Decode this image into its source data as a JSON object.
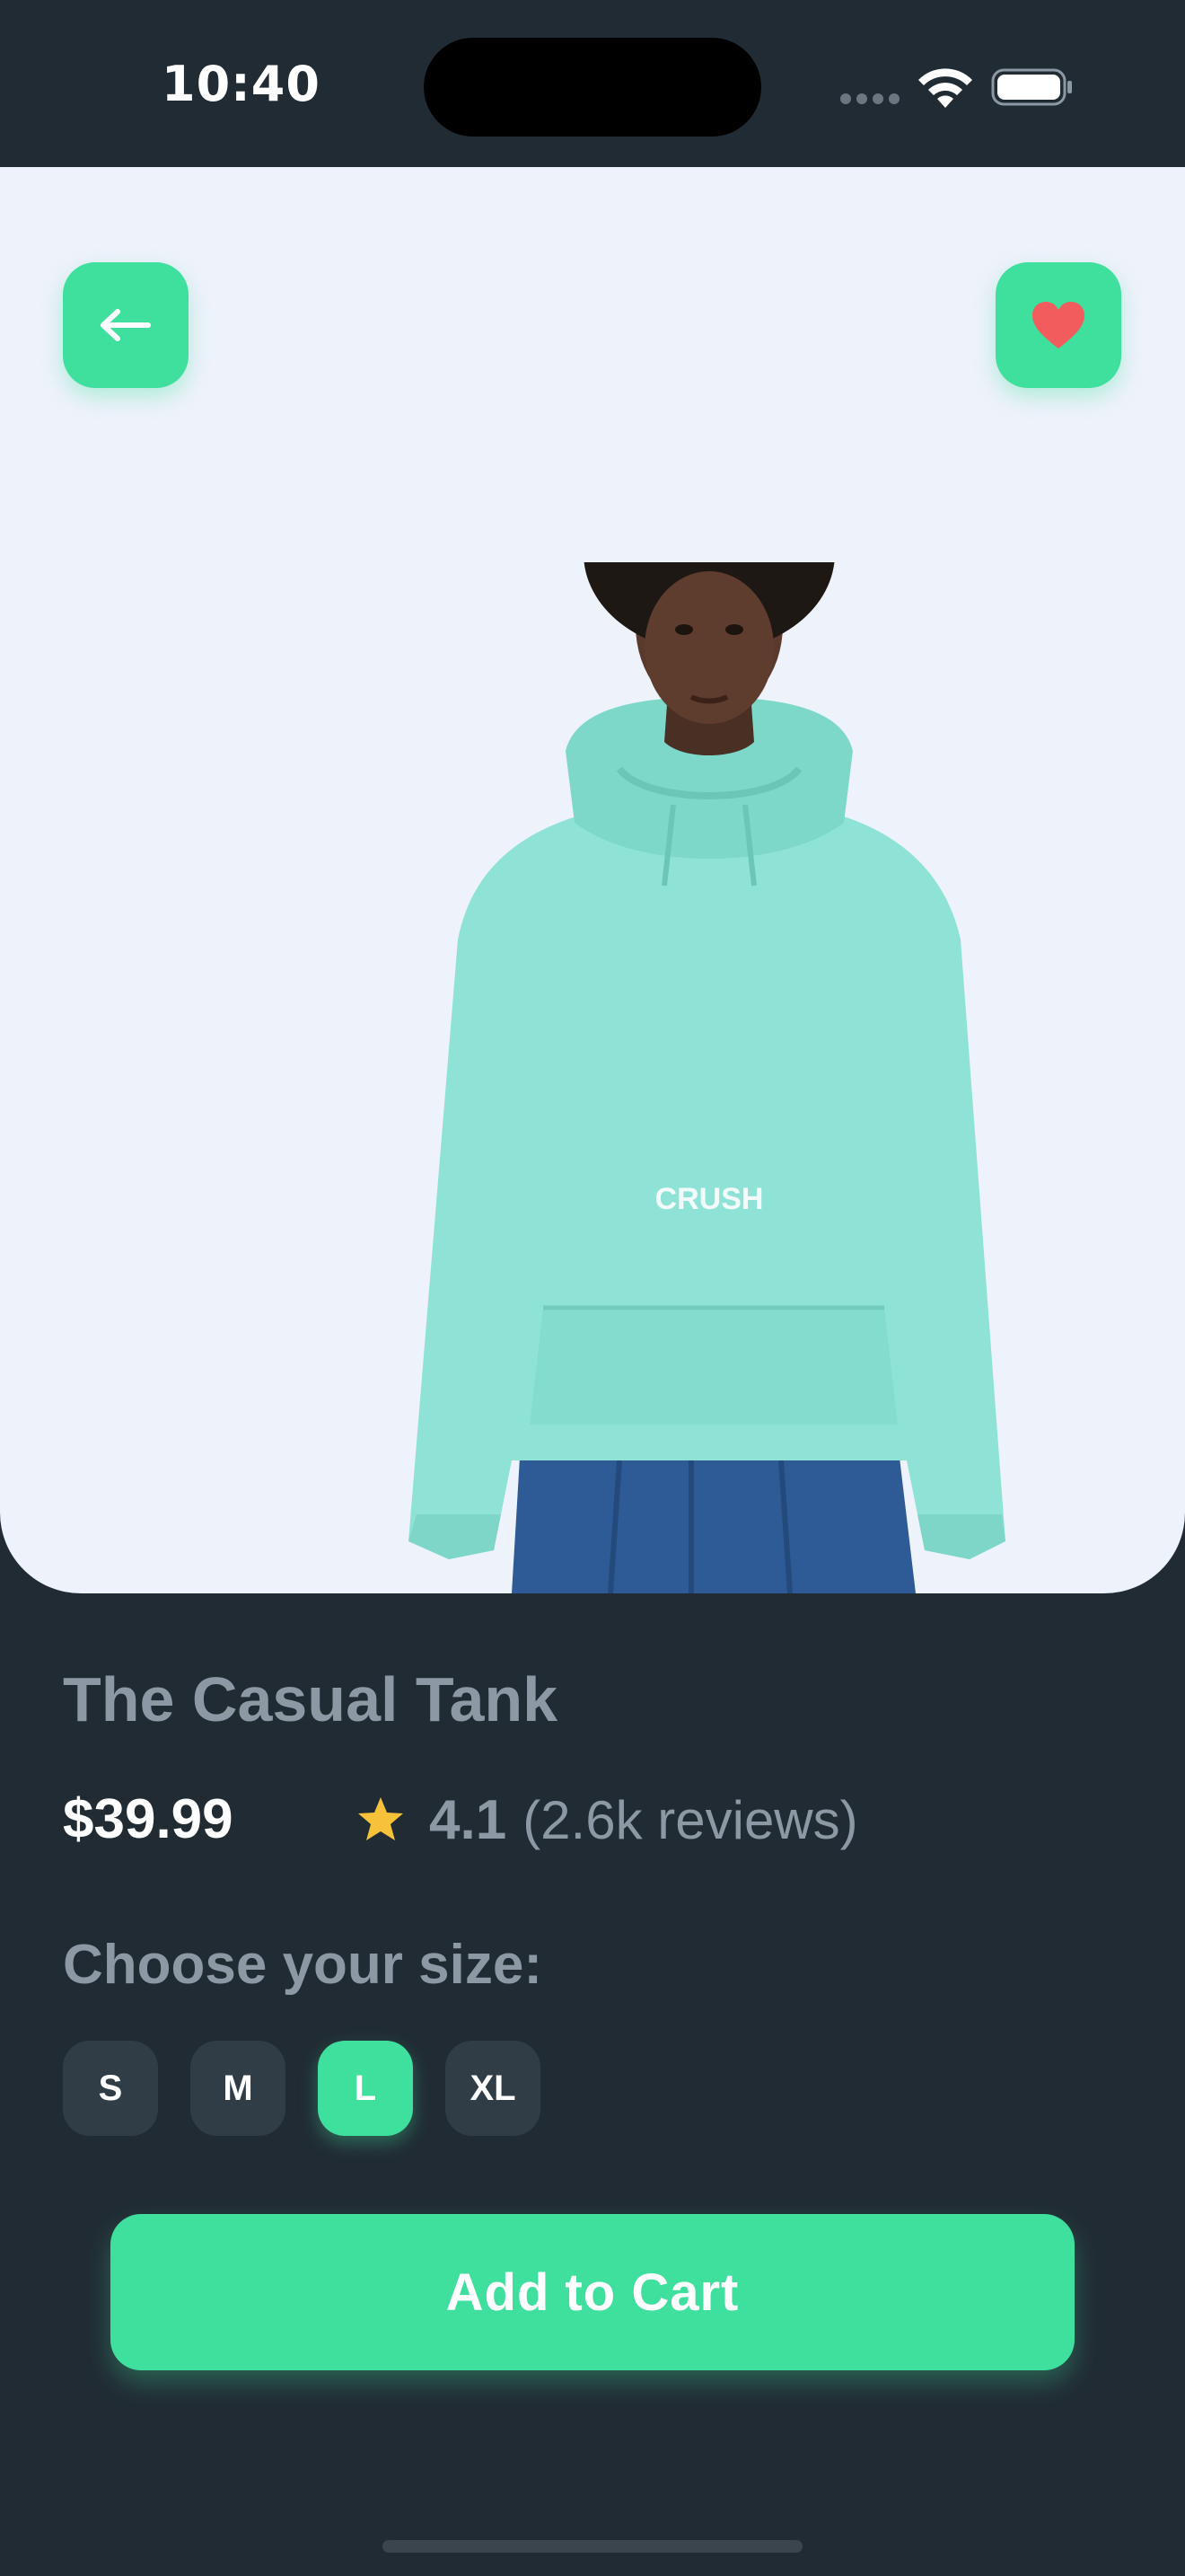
{
  "status_bar": {
    "time": "10:40"
  },
  "hero": {
    "back_icon": "arrow-left-icon",
    "favorite_icon": "heart-icon",
    "favorite_color": "#f25c5c",
    "sweater_print": "CRUSH"
  },
  "product": {
    "title": "The Casual Tank",
    "price": "$39.99",
    "rating": "4.1",
    "reviews": "(2.6k reviews)",
    "star_color": "#f7c13a"
  },
  "sizes": {
    "heading": "Choose your size:",
    "options": [
      "S",
      "M",
      "L",
      "XL"
    ],
    "selected": "L"
  },
  "cart": {
    "button_label": "Add to Cart"
  },
  "colors": {
    "accent": "#3fdf9e",
    "background": "#212b33",
    "chip": "#303d47",
    "muted_text": "#8c98a3",
    "hero_bg": "#eef2fb"
  }
}
